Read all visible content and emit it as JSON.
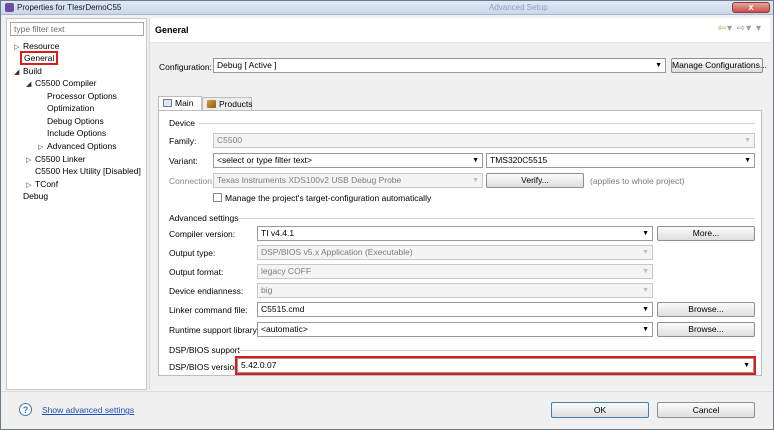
{
  "window": {
    "title": "Properties for TIesrDemoC55",
    "ghost_title": "Advanced Setup",
    "close_glyph": "x"
  },
  "filter": {
    "placeholder": "type filter text"
  },
  "tree": {
    "resource": "Resource",
    "general": "General",
    "build": "Build",
    "compiler": "C5500 Compiler",
    "processor_options": "Processor Options",
    "optimization": "Optimization",
    "debug_options": "Debug Options",
    "include_options": "Include Options",
    "advanced_options": "Advanced Options",
    "linker": "C5500 Linker",
    "hex_utility": "C5500 Hex Utility  [Disabled]",
    "tconf": "TConf",
    "debug": "Debug"
  },
  "header": {
    "title": "General"
  },
  "configuration": {
    "label": "Configuration:",
    "value": "Debug  [ Active ]",
    "manage_label": "Manage Configurations..."
  },
  "tabs": {
    "main": "Main",
    "products": "Products"
  },
  "device": {
    "group_title": "Device",
    "family_label": "Family:",
    "family_value": "C5500",
    "variant_label": "Variant:",
    "variant_filter": "<select or type filter text>",
    "variant_value": "TMS320C5515",
    "connection_label": "Connection:",
    "connection_value": "Texas Instruments XDS100v2 USB Debug Probe",
    "verify_label": "Verify...",
    "verify_hint": "(applies to whole project)",
    "manage_target_label": "Manage the project's target-configuration automatically"
  },
  "advanced": {
    "group_title": "Advanced settings",
    "compiler_label": "Compiler version:",
    "compiler_value": "TI v4.4.1",
    "more_label": "More...",
    "output_type_label": "Output type:",
    "output_type_value": "DSP/BIOS v5.x Application (Executable)",
    "output_format_label": "Output format:",
    "output_format_value": "legacy COFF",
    "endianness_label": "Device endianness:",
    "endianness_value": "big",
    "linker_cmd_label": "Linker command file:",
    "linker_cmd_value": "C5515.cmd",
    "browse1_label": "Browse...",
    "runtime_label": "Runtime support library:",
    "runtime_value": "<automatic>",
    "browse2_label": "Browse..."
  },
  "dspbios": {
    "group_title": "DSP/BIOS support",
    "version_label": "DSP/BIOS version:",
    "version_value": "5.42.0.07"
  },
  "footer": {
    "help_glyph": "?",
    "show_advanced": "Show advanced settings",
    "ok": "OK",
    "cancel": "Cancel"
  }
}
